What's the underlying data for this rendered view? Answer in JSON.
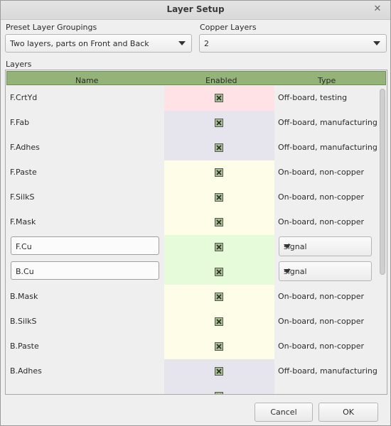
{
  "window": {
    "title": "Layer Setup"
  },
  "preset": {
    "label": "Preset Layer Groupings",
    "value": "Two layers, parts on Front and Back"
  },
  "copper": {
    "label": "Copper Layers",
    "value": "2"
  },
  "layers": {
    "label": "Layers",
    "columns": {
      "name": "Name",
      "enabled": "Enabled",
      "type": "Type"
    },
    "rows": [
      {
        "name": "F.CrtYd",
        "type": "Off-board, testing",
        "color": "#ffe2e6",
        "enabled": true,
        "editable": false
      },
      {
        "name": "F.Fab",
        "type": "Off-board, manufacturing",
        "color": "#e6e4ec",
        "enabled": true,
        "editable": false
      },
      {
        "name": "F.Adhes",
        "type": "Off-board, manufacturing",
        "color": "#e6e4ec",
        "enabled": true,
        "editable": false
      },
      {
        "name": "F.Paste",
        "type": "On-board, non-copper",
        "color": "#fdfde8",
        "enabled": true,
        "editable": false
      },
      {
        "name": "F.SilkS",
        "type": "On-board, non-copper",
        "color": "#fdfde8",
        "enabled": true,
        "editable": false
      },
      {
        "name": "F.Mask",
        "type": "On-board, non-copper",
        "color": "#fdfde8",
        "enabled": true,
        "editable": false
      },
      {
        "name": "F.Cu",
        "type": "signal",
        "color": "#e5fbd9",
        "enabled": true,
        "editable": true
      },
      {
        "name": "B.Cu",
        "type": "signal",
        "color": "#e5fbd9",
        "enabled": true,
        "editable": true
      },
      {
        "name": "B.Mask",
        "type": "On-board, non-copper",
        "color": "#fdfde8",
        "enabled": true,
        "editable": false
      },
      {
        "name": "B.SilkS",
        "type": "On-board, non-copper",
        "color": "#fdfde8",
        "enabled": true,
        "editable": false
      },
      {
        "name": "B.Paste",
        "type": "On-board, non-copper",
        "color": "#fdfde8",
        "enabled": true,
        "editable": false
      },
      {
        "name": "B.Adhes",
        "type": "Off-board, manufacturing",
        "color": "#e6e4ec",
        "enabled": true,
        "editable": false
      },
      {
        "name": "",
        "type": "",
        "color": "#e6e4ec",
        "enabled": true,
        "editable": false
      }
    ]
  },
  "buttons": {
    "cancel": "Cancel",
    "ok": "OK"
  }
}
